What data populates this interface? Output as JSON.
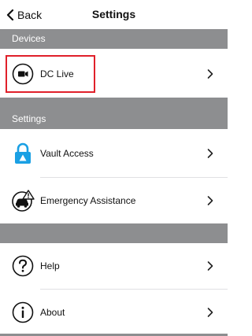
{
  "navbar": {
    "back_label": "Back",
    "title": "Settings"
  },
  "sections": {
    "devices_header": "Devices",
    "settings_header": "Settings"
  },
  "rows": {
    "dc_live": {
      "label": "DC Live",
      "icon": "video-camera-icon"
    },
    "vault_access": {
      "label": "Vault Access",
      "icon": "lock-icon"
    },
    "emergency_assistance": {
      "label": "Emergency Assistance",
      "icon": "roadside-warning-icon"
    },
    "help": {
      "label": "Help",
      "icon": "question-icon"
    },
    "about": {
      "label": "About",
      "icon": "info-icon"
    }
  },
  "colors": {
    "section_bg": "#8d8e90",
    "accent_blue": "#1aa0e4",
    "highlight_red": "#e0202a"
  }
}
